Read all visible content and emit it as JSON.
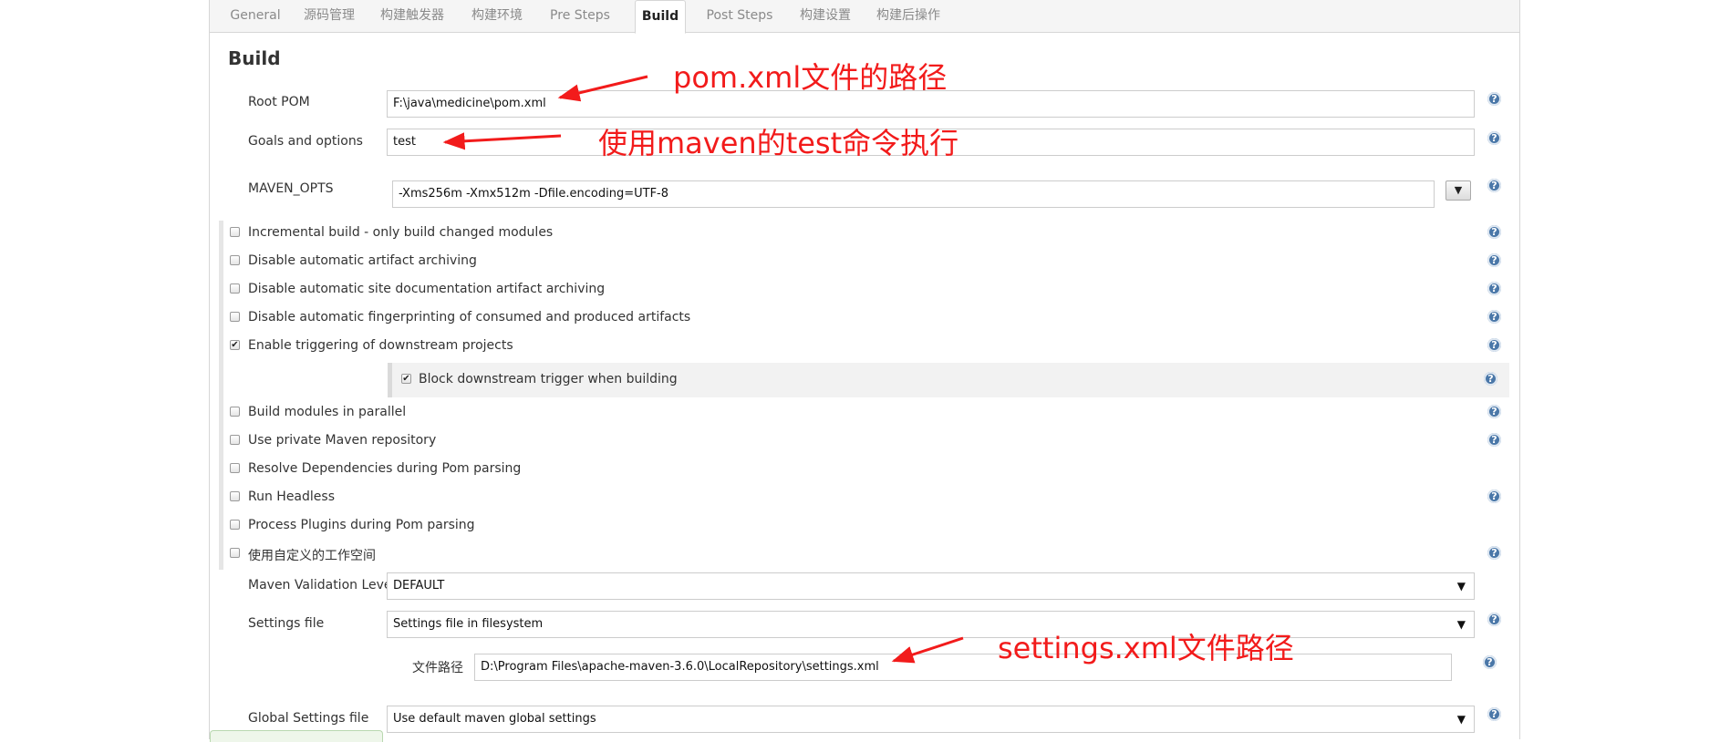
{
  "tabs": [
    {
      "label": "General",
      "active": false
    },
    {
      "label": "源码管理",
      "active": false
    },
    {
      "label": "构建触发器",
      "active": false
    },
    {
      "label": "构建环境",
      "active": false
    },
    {
      "label": "Pre Steps",
      "active": false
    },
    {
      "label": "Build",
      "active": true
    },
    {
      "label": "Post Steps",
      "active": false
    },
    {
      "label": "构建设置",
      "active": false
    },
    {
      "label": "构建后操作",
      "active": false
    }
  ],
  "section": {
    "title": "Build"
  },
  "fields": {
    "root_pom": {
      "label": "Root POM",
      "value": "F:\\java\\medicine\\pom.xml"
    },
    "goals": {
      "label": "Goals and options",
      "value": "test"
    },
    "maven_opts": {
      "label": "MAVEN_OPTS",
      "value": "-Xms256m -Xmx512m -Dfile.encoding=UTF-8",
      "button": "▼"
    }
  },
  "checkboxes": [
    {
      "label": "Incremental build - only build changed modules",
      "checked": false,
      "help": true
    },
    {
      "label": "Disable automatic artifact archiving",
      "checked": false,
      "help": true
    },
    {
      "label": "Disable automatic site documentation artifact archiving",
      "checked": false,
      "help": true
    },
    {
      "label": "Disable automatic fingerprinting of consumed and produced artifacts",
      "checked": false,
      "help": true
    },
    {
      "label": "Enable triggering of downstream projects",
      "checked": true,
      "help": true
    },
    {
      "label": "Block downstream trigger when building",
      "checked": true,
      "help": true
    },
    {
      "label": "Build modules in parallel",
      "checked": false,
      "help": true
    },
    {
      "label": "Use private Maven repository",
      "checked": false,
      "help": true
    },
    {
      "label": "Resolve Dependencies during Pom parsing",
      "checked": false,
      "help": false
    },
    {
      "label": "Run Headless",
      "checked": false,
      "help": true
    },
    {
      "label": "Process Plugins during Pom parsing",
      "checked": false,
      "help": false
    },
    {
      "label": "使用自定义的工作空间",
      "checked": false,
      "help": true
    }
  ],
  "selects": {
    "validation": {
      "label": "Maven Validation Level",
      "value": "DEFAULT"
    },
    "settings": {
      "label": "Settings file",
      "value": "Settings file in filesystem"
    },
    "file_path": {
      "label": "文件路径",
      "value": "D:\\Program Files\\apache-maven-3.6.0\\LocalRepository\\settings.xml"
    },
    "global_settings": {
      "label": "Global Settings file",
      "value": "Use default maven global settings"
    }
  },
  "annotations": {
    "pom": "pom.xml文件的路径",
    "test": "使用maven的test命令执行",
    "settings": "settings.xml文件路径"
  },
  "glyphs": {
    "help": "?",
    "check": "✔",
    "caret": "▼"
  },
  "colors": {
    "annotation": "#f21b1b",
    "help_icon": "#4a77a8"
  }
}
